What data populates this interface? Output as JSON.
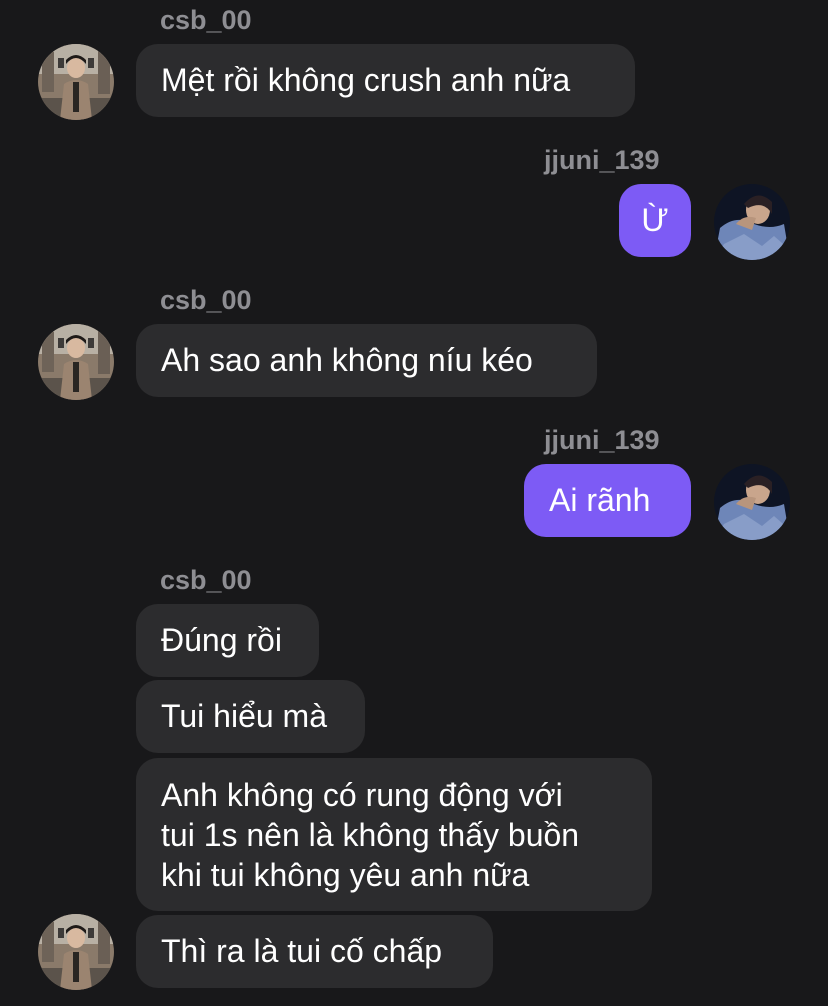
{
  "messages": [
    {
      "sender": "csb_00",
      "side": "left",
      "text": "Mệt rồi không crush anh nữa"
    },
    {
      "sender": "jjuni_139",
      "side": "right",
      "text": "Ừ"
    },
    {
      "sender": "csb_00",
      "side": "left",
      "text": "Ah sao anh không níu kéo"
    },
    {
      "sender": "jjuni_139",
      "side": "right",
      "text": "Ai rãnh"
    },
    {
      "sender": "csb_00",
      "side": "left",
      "text": "Đúng rồi"
    },
    {
      "sender": "csb_00",
      "side": "left",
      "text": "Tui hiểu mà"
    },
    {
      "sender": "csb_00",
      "side": "left",
      "lines": [
        "Anh không có rung động với",
        "tui 1s nên là không thấy buồn",
        "khi tui không yêu anh nữa"
      ]
    },
    {
      "sender": "csb_00",
      "side": "left",
      "text": "Thì ra là tui cố chấp"
    }
  ],
  "users": {
    "left": {
      "username": "csb_00",
      "avatar_icon": "avatar-photo-street"
    },
    "right": {
      "username": "jjuni_139",
      "avatar_icon": "avatar-photo-blue-shirt"
    }
  },
  "colors": {
    "background": "#18181a",
    "incoming_bubble": "#2c2c2e",
    "outgoing_bubble": "#7d5bf5",
    "username": "#8e8e93"
  }
}
